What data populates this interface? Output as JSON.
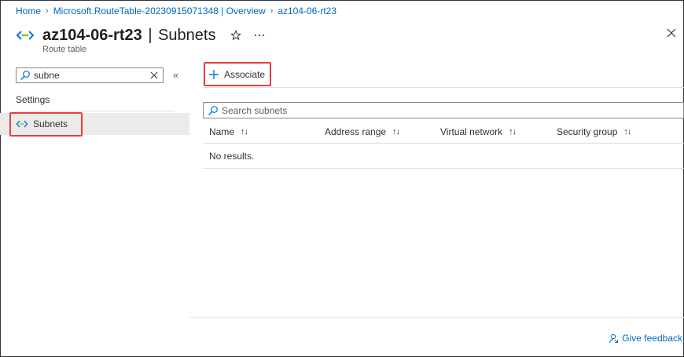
{
  "breadcrumb": {
    "items": [
      "Home",
      "Microsoft.RouteTable-20230915071348 | Overview",
      "az104-06-rt23"
    ]
  },
  "header": {
    "resource_name": "az104-06-rt23",
    "separator": "|",
    "blade_name": "Subnets",
    "subtitle": "Route table",
    "icons": [
      "route-table-icon",
      "star-icon",
      "more-icon",
      "close-icon"
    ]
  },
  "left_nav": {
    "search_value": "subne",
    "section_label": "Settings",
    "items": [
      {
        "label": "Subnets",
        "icon": "route-table-icon",
        "selected": true
      }
    ]
  },
  "toolbar": {
    "associate_label": "Associate"
  },
  "grid": {
    "search_placeholder": "Search subnets",
    "columns": [
      "Name",
      "Address range",
      "Virtual network",
      "Security group"
    ],
    "sort_glyph": "↑↓",
    "empty_text": "No results."
  },
  "footer": {
    "feedback_label": "Give feedback"
  },
  "colors": {
    "link": "#0067b8",
    "highlight_box": "#e83c3c",
    "selected_nav_bg": "#edebe9",
    "icon_accent": "#0078d4",
    "icon_green": "#7fba00"
  }
}
